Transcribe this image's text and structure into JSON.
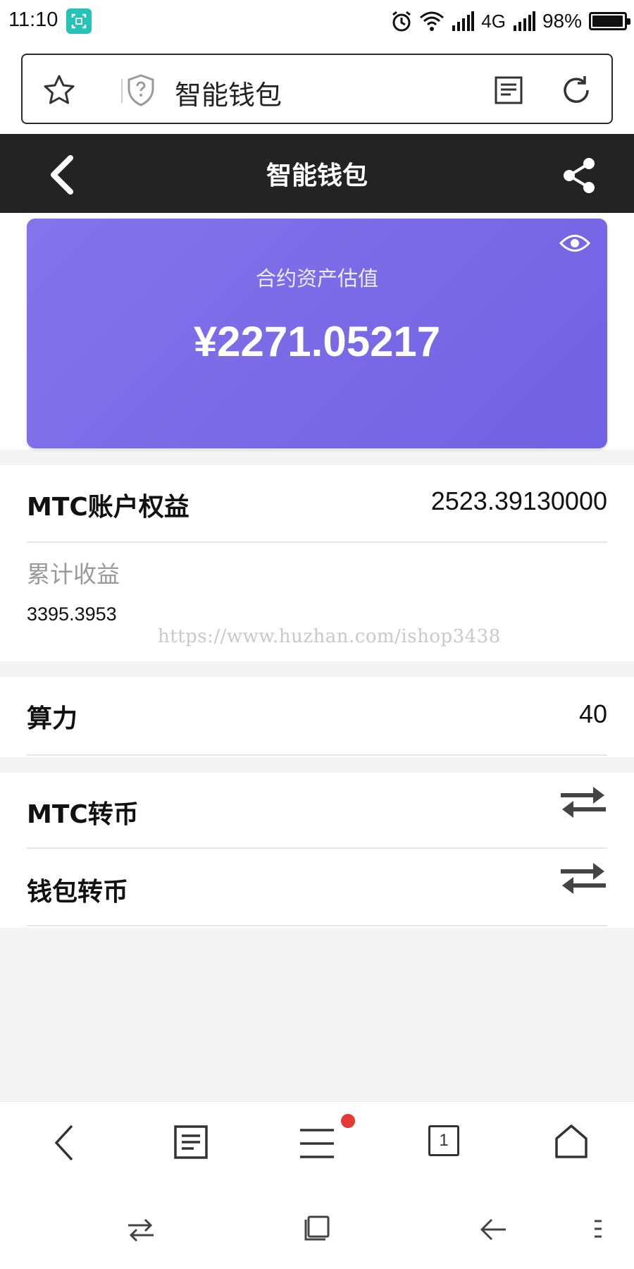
{
  "status_bar": {
    "time": "11:10",
    "network": "4G",
    "battery_text": "98%",
    "battery_level": 0.98
  },
  "browser": {
    "url_title": "智能钱包"
  },
  "app_header": {
    "title": "智能钱包"
  },
  "asset_card": {
    "label": "合约资产估值",
    "value": "¥2271.05217"
  },
  "equity": {
    "label": "MTC账户权益",
    "value": "2523.39130000",
    "cumulative_label": "累计收益",
    "cumulative_value": "3395.3953"
  },
  "hashrate": {
    "label": "算力",
    "value": "40"
  },
  "actions": [
    {
      "label": "MTC转币"
    },
    {
      "label": "钱包转币"
    }
  ],
  "watermark": "https://www.huzhan.com/ishop3438",
  "bottom_nav": {
    "tab_count": "1"
  },
  "colors": {
    "card_gradient_start": "#8474ec",
    "card_gradient_end": "#7262e4",
    "header_bg": "#232323",
    "notification_dot": "#e53935"
  }
}
